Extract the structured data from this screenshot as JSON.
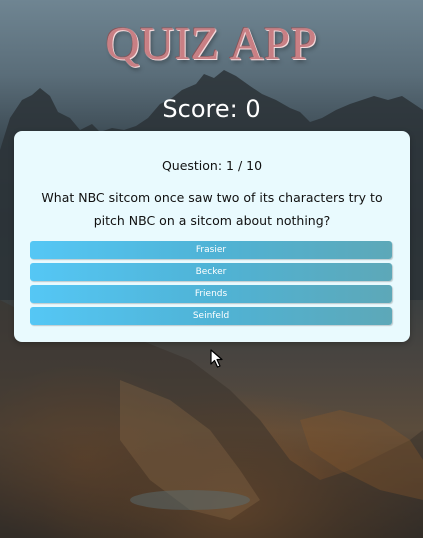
{
  "app": {
    "title": "QUIZ APP",
    "score_label": "Score: 0"
  },
  "quiz": {
    "progress": "Question: 1 / 10",
    "question": "What NBC sitcom once saw two of its characters try to pitch NBC on a sitcom about nothing?",
    "answers": [
      "Frasier",
      "Becker",
      "Friends",
      "Seinfeld"
    ]
  },
  "colors": {
    "card_background": "#e9fafe",
    "answer_gradient_start": "#55c7f5",
    "answer_gradient_end": "#5da8b8",
    "title_color": "#c97f84"
  },
  "icons": {
    "cursor": "mouse-pointer-icon"
  }
}
